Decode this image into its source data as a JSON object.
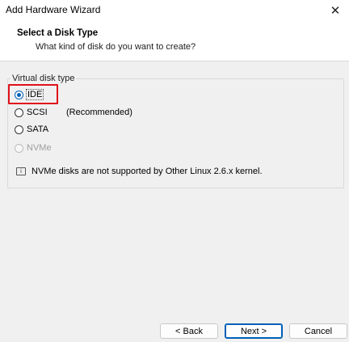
{
  "window": {
    "title": "Add Hardware Wizard",
    "close_glyph": "✕"
  },
  "header": {
    "title": "Select a Disk Type",
    "subtitle": "What kind of disk do you want to create?"
  },
  "disk_type_group": {
    "legend": "Virtual disk type",
    "options": [
      {
        "label": "IDE",
        "checked": true,
        "enabled": true
      },
      {
        "label": "SCSI",
        "checked": false,
        "enabled": true,
        "note": "(Recommended)"
      },
      {
        "label": "SATA",
        "checked": false,
        "enabled": true
      },
      {
        "label": "NVMe",
        "checked": false,
        "enabled": false
      }
    ],
    "info_icon": "info-icon",
    "info_text": "NVMe disks are not supported by Other Linux 2.6.x kernel."
  },
  "buttons": {
    "back": "< Back",
    "next": "Next >",
    "cancel": "Cancel"
  },
  "colors": {
    "highlight": "#e0101a",
    "accent": "#005fb8"
  }
}
